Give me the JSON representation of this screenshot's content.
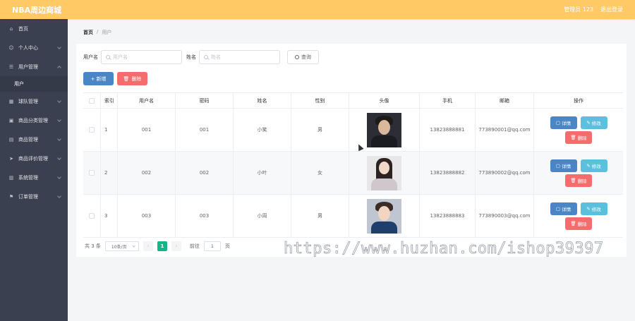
{
  "app": {
    "title": "NBA周边商城"
  },
  "topbar": {
    "user_label": "管理员 123",
    "logout_label": "退出登录"
  },
  "sidebar": {
    "items": [
      {
        "label": "首页",
        "icon": "home-icon",
        "has_chevron": false
      },
      {
        "label": "个人中心",
        "icon": "user-icon",
        "has_chevron": true
      },
      {
        "label": "用户管理",
        "icon": "users-icon",
        "has_chevron": true,
        "expanded": true
      },
      {
        "label": "球队管理",
        "icon": "grid-icon",
        "has_chevron": true
      },
      {
        "label": "商品分类管理",
        "icon": "cart-icon",
        "has_chevron": true
      },
      {
        "label": "商品管理",
        "icon": "table-icon",
        "has_chevron": true
      },
      {
        "label": "商品评价管理",
        "icon": "send-icon",
        "has_chevron": true
      },
      {
        "label": "系统管理",
        "icon": "chart-icon",
        "has_chevron": true
      },
      {
        "label": "订单管理",
        "icon": "flag-icon",
        "has_chevron": true
      }
    ],
    "submenu": {
      "label": "用户"
    }
  },
  "breadcrumb": {
    "home": "首页",
    "separator": "/",
    "current": "用户"
  },
  "search": {
    "username_label": "用户名",
    "username_placeholder": "用户名",
    "name_label": "姓名",
    "name_placeholder": "姓名",
    "query_label": "查询"
  },
  "actions": {
    "add_label": "+ 新增",
    "delete_label": "删除"
  },
  "table": {
    "headers": [
      "索引",
      "用户名",
      "密码",
      "姓名",
      "性别",
      "头像",
      "手机",
      "邮箱",
      "操作"
    ],
    "rows": [
      {
        "index": "1",
        "username": "001",
        "password": "001",
        "name": "小笑",
        "gender": "男",
        "phone": "13823888881",
        "email": "773890001@qq.com"
      },
      {
        "index": "2",
        "username": "002",
        "password": "002",
        "name": "小叶",
        "gender": "女",
        "phone": "13823888882",
        "email": "773890002@qq.com"
      },
      {
        "index": "3",
        "username": "003",
        "password": "003",
        "name": "小周",
        "gender": "男",
        "phone": "13823888883",
        "email": "773890003@qq.com"
      }
    ],
    "row_actions": {
      "detail": "详情",
      "edit": "修改",
      "delete": "删除"
    }
  },
  "pager": {
    "total": "共 3 条",
    "page_size": "10条/页",
    "prev": "‹",
    "current_page": "1",
    "next": "›",
    "goto_label": "前往",
    "goto_value": "1",
    "page_suffix": "页"
  },
  "watermark": "https://www.huzhan.com/ishop39397",
  "colors": {
    "topbar": "#ffc966",
    "sidebar": "#3b4050",
    "primary": "#4a86c5",
    "danger": "#f56c6c",
    "info": "#5bc0de",
    "pager_active": "#13b787"
  }
}
